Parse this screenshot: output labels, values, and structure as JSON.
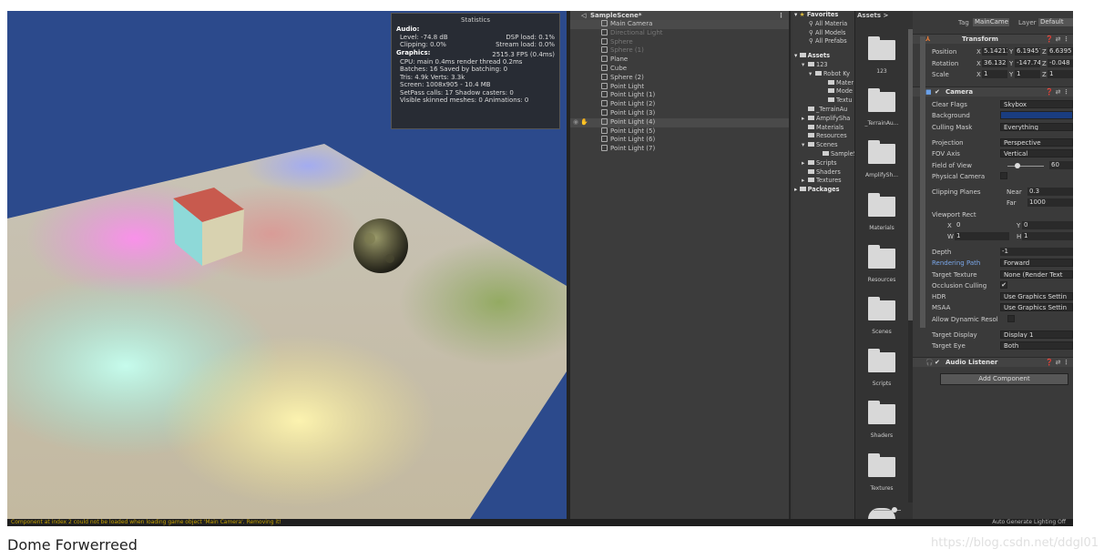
{
  "statistics": {
    "title": "Statistics",
    "audio_header": "Audio:",
    "audio_rows": [
      [
        "Level: -74.8 dB",
        "DSP load: 0.1%"
      ],
      [
        "Clipping: 0.0%",
        "Stream load: 0.0%"
      ]
    ],
    "graphics_header": "Graphics:",
    "fps": "2515.3 FPS (0.4ms)",
    "lines": [
      "CPU: main 0.4ms  render thread 0.2ms",
      "Batches: 16     Saved by batching: 0",
      "Tris: 4.9k      Verts: 3.3k",
      "Screen: 1008x905 - 10.4 MB",
      "SetPass calls: 17        Shadow casters: 0",
      "Visible skinned meshes: 0  Animations: 0"
    ]
  },
  "status_bar": {
    "left": "Component at index 2 could not be loaded when loading game object 'Main Camera'. Removing it!",
    "right": "Auto Generate Lighting Off"
  },
  "hierarchy": {
    "scene": "SampleScene*",
    "menu": "⋮",
    "items": [
      {
        "label": "Main Camera",
        "state": "selected"
      },
      {
        "label": "Directional Light",
        "state": "disabled"
      },
      {
        "label": "Sphere",
        "state": "disabled"
      },
      {
        "label": "Sphere (1)",
        "state": "disabled"
      },
      {
        "label": "Plane",
        "state": "normal"
      },
      {
        "label": "Cube",
        "state": "normal"
      },
      {
        "label": "Sphere (2)",
        "state": "normal"
      },
      {
        "label": "Point Light",
        "state": "normal"
      },
      {
        "label": "Point Light (1)",
        "state": "normal"
      },
      {
        "label": "Point Light (2)",
        "state": "normal"
      },
      {
        "label": "Point Light (3)",
        "state": "normal"
      },
      {
        "label": "Point Light (4)",
        "state": "selected"
      },
      {
        "label": "Point Light (5)",
        "state": "normal"
      },
      {
        "label": "Point Light (6)",
        "state": "normal"
      },
      {
        "label": "Point Light (7)",
        "state": "normal"
      }
    ]
  },
  "project": {
    "favorites_label": "Favorites",
    "favorites": [
      "All Materia",
      "All Models",
      "All Prefabs"
    ],
    "assets_label": "Assets",
    "tree": [
      {
        "label": "123"
      },
      {
        "label": "Robot Ky"
      },
      {
        "label": "Mater"
      },
      {
        "label": "Mode"
      },
      {
        "label": "Textu"
      },
      {
        "label": "_TerrainAu"
      },
      {
        "label": "AmplifySha"
      },
      {
        "label": "Materials"
      },
      {
        "label": "Resources"
      },
      {
        "label": "Scenes"
      },
      {
        "label": "SampleS"
      },
      {
        "label": "Scripts"
      },
      {
        "label": "Shaders"
      },
      {
        "label": "Textures"
      }
    ],
    "packages_label": "Packages"
  },
  "assets": {
    "header": "Assets >",
    "folders": [
      "123",
      "_TerrainAu...",
      "AmplifySh...",
      "Materials",
      "Resources",
      "Scenes",
      "Scripts",
      "Shaders",
      "Textures"
    ]
  },
  "inspector": {
    "tag_label": "Tag",
    "tag_value": "MainCame",
    "layer_label": "Layer",
    "layer_value": "Default",
    "transform_label": "Transform",
    "position_label": "Position",
    "position": [
      "5.14211",
      "6.19457",
      "6.6395"
    ],
    "rotation_label": "Rotation",
    "rotation": [
      "36.132",
      "-147.74",
      "-0.048"
    ],
    "scale_label": "Scale",
    "scale": [
      "1",
      "1",
      "1"
    ],
    "camera_label": "Camera",
    "clear_flags_label": "Clear Flags",
    "clear_flags": "Skybox",
    "background_label": "Background",
    "background_color": "#1a3d80",
    "culling_mask_label": "Culling Mask",
    "culling_mask": "Everything",
    "projection_label": "Projection",
    "projection": "Perspective",
    "fov_axis_label": "FOV Axis",
    "fov_axis": "Vertical",
    "field_of_view_label": "Field of View",
    "field_of_view": "60",
    "field_of_view_fraction": 0.28,
    "physical_camera_label": "Physical Camera",
    "clipping_label": "Clipping Planes",
    "near_label": "Near",
    "near": "0.3",
    "far_label": "Far",
    "far": "1000",
    "viewport_label": "Viewport Rect",
    "vp_x": "0",
    "vp_y": "0",
    "vp_w": "1",
    "vp_h": "1",
    "depth_label": "Depth",
    "depth": "-1",
    "rendering_path_label": "Rendering Path",
    "rendering_path": "Forward",
    "target_texture_label": "Target Texture",
    "target_texture": "None (Render Text",
    "occlusion_label": "Occlusion Culling",
    "hdr_label": "HDR",
    "hdr": "Use Graphics Settin",
    "msaa_label": "MSAA",
    "msaa": "Use Graphics Settin",
    "dynamic_res_label": "Allow Dynamic Resol",
    "target_display_label": "Target Display",
    "target_display": "Display 1",
    "target_eye_label": "Target Eye",
    "target_eye": "Both",
    "audio_listener_label": "Audio Listener",
    "add_component": "Add Component"
  },
  "caption": "Dome Forwerreed",
  "watermark": "https://blog.csdn.net/ddgl01"
}
